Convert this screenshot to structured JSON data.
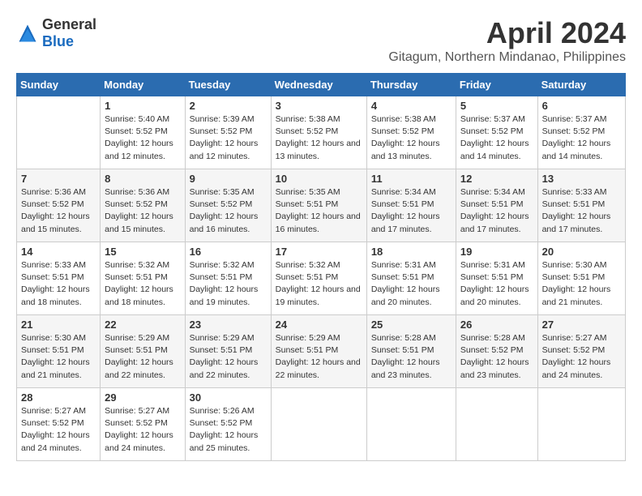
{
  "logo": {
    "general": "General",
    "blue": "Blue"
  },
  "title": "April 2024",
  "location": "Gitagum, Northern Mindanao, Philippines",
  "days_of_week": [
    "Sunday",
    "Monday",
    "Tuesday",
    "Wednesday",
    "Thursday",
    "Friday",
    "Saturday"
  ],
  "weeks": [
    [
      {
        "day": "",
        "sunrise": "",
        "sunset": "",
        "daylight": ""
      },
      {
        "day": "1",
        "sunrise": "Sunrise: 5:40 AM",
        "sunset": "Sunset: 5:52 PM",
        "daylight": "Daylight: 12 hours and 12 minutes."
      },
      {
        "day": "2",
        "sunrise": "Sunrise: 5:39 AM",
        "sunset": "Sunset: 5:52 PM",
        "daylight": "Daylight: 12 hours and 12 minutes."
      },
      {
        "day": "3",
        "sunrise": "Sunrise: 5:38 AM",
        "sunset": "Sunset: 5:52 PM",
        "daylight": "Daylight: 12 hours and 13 minutes."
      },
      {
        "day": "4",
        "sunrise": "Sunrise: 5:38 AM",
        "sunset": "Sunset: 5:52 PM",
        "daylight": "Daylight: 12 hours and 13 minutes."
      },
      {
        "day": "5",
        "sunrise": "Sunrise: 5:37 AM",
        "sunset": "Sunset: 5:52 PM",
        "daylight": "Daylight: 12 hours and 14 minutes."
      },
      {
        "day": "6",
        "sunrise": "Sunrise: 5:37 AM",
        "sunset": "Sunset: 5:52 PM",
        "daylight": "Daylight: 12 hours and 14 minutes."
      }
    ],
    [
      {
        "day": "7",
        "sunrise": "Sunrise: 5:36 AM",
        "sunset": "Sunset: 5:52 PM",
        "daylight": "Daylight: 12 hours and 15 minutes."
      },
      {
        "day": "8",
        "sunrise": "Sunrise: 5:36 AM",
        "sunset": "Sunset: 5:52 PM",
        "daylight": "Daylight: 12 hours and 15 minutes."
      },
      {
        "day": "9",
        "sunrise": "Sunrise: 5:35 AM",
        "sunset": "Sunset: 5:52 PM",
        "daylight": "Daylight: 12 hours and 16 minutes."
      },
      {
        "day": "10",
        "sunrise": "Sunrise: 5:35 AM",
        "sunset": "Sunset: 5:51 PM",
        "daylight": "Daylight: 12 hours and 16 minutes."
      },
      {
        "day": "11",
        "sunrise": "Sunrise: 5:34 AM",
        "sunset": "Sunset: 5:51 PM",
        "daylight": "Daylight: 12 hours and 17 minutes."
      },
      {
        "day": "12",
        "sunrise": "Sunrise: 5:34 AM",
        "sunset": "Sunset: 5:51 PM",
        "daylight": "Daylight: 12 hours and 17 minutes."
      },
      {
        "day": "13",
        "sunrise": "Sunrise: 5:33 AM",
        "sunset": "Sunset: 5:51 PM",
        "daylight": "Daylight: 12 hours and 17 minutes."
      }
    ],
    [
      {
        "day": "14",
        "sunrise": "Sunrise: 5:33 AM",
        "sunset": "Sunset: 5:51 PM",
        "daylight": "Daylight: 12 hours and 18 minutes."
      },
      {
        "day": "15",
        "sunrise": "Sunrise: 5:32 AM",
        "sunset": "Sunset: 5:51 PM",
        "daylight": "Daylight: 12 hours and 18 minutes."
      },
      {
        "day": "16",
        "sunrise": "Sunrise: 5:32 AM",
        "sunset": "Sunset: 5:51 PM",
        "daylight": "Daylight: 12 hours and 19 minutes."
      },
      {
        "day": "17",
        "sunrise": "Sunrise: 5:32 AM",
        "sunset": "Sunset: 5:51 PM",
        "daylight": "Daylight: 12 hours and 19 minutes."
      },
      {
        "day": "18",
        "sunrise": "Sunrise: 5:31 AM",
        "sunset": "Sunset: 5:51 PM",
        "daylight": "Daylight: 12 hours and 20 minutes."
      },
      {
        "day": "19",
        "sunrise": "Sunrise: 5:31 AM",
        "sunset": "Sunset: 5:51 PM",
        "daylight": "Daylight: 12 hours and 20 minutes."
      },
      {
        "day": "20",
        "sunrise": "Sunrise: 5:30 AM",
        "sunset": "Sunset: 5:51 PM",
        "daylight": "Daylight: 12 hours and 21 minutes."
      }
    ],
    [
      {
        "day": "21",
        "sunrise": "Sunrise: 5:30 AM",
        "sunset": "Sunset: 5:51 PM",
        "daylight": "Daylight: 12 hours and 21 minutes."
      },
      {
        "day": "22",
        "sunrise": "Sunrise: 5:29 AM",
        "sunset": "Sunset: 5:51 PM",
        "daylight": "Daylight: 12 hours and 22 minutes."
      },
      {
        "day": "23",
        "sunrise": "Sunrise: 5:29 AM",
        "sunset": "Sunset: 5:51 PM",
        "daylight": "Daylight: 12 hours and 22 minutes."
      },
      {
        "day": "24",
        "sunrise": "Sunrise: 5:29 AM",
        "sunset": "Sunset: 5:51 PM",
        "daylight": "Daylight: 12 hours and 22 minutes."
      },
      {
        "day": "25",
        "sunrise": "Sunrise: 5:28 AM",
        "sunset": "Sunset: 5:51 PM",
        "daylight": "Daylight: 12 hours and 23 minutes."
      },
      {
        "day": "26",
        "sunrise": "Sunrise: 5:28 AM",
        "sunset": "Sunset: 5:52 PM",
        "daylight": "Daylight: 12 hours and 23 minutes."
      },
      {
        "day": "27",
        "sunrise": "Sunrise: 5:27 AM",
        "sunset": "Sunset: 5:52 PM",
        "daylight": "Daylight: 12 hours and 24 minutes."
      }
    ],
    [
      {
        "day": "28",
        "sunrise": "Sunrise: 5:27 AM",
        "sunset": "Sunset: 5:52 PM",
        "daylight": "Daylight: 12 hours and 24 minutes."
      },
      {
        "day": "29",
        "sunrise": "Sunrise: 5:27 AM",
        "sunset": "Sunset: 5:52 PM",
        "daylight": "Daylight: 12 hours and 24 minutes."
      },
      {
        "day": "30",
        "sunrise": "Sunrise: 5:26 AM",
        "sunset": "Sunset: 5:52 PM",
        "daylight": "Daylight: 12 hours and 25 minutes."
      },
      {
        "day": "",
        "sunrise": "",
        "sunset": "",
        "daylight": ""
      },
      {
        "day": "",
        "sunrise": "",
        "sunset": "",
        "daylight": ""
      },
      {
        "day": "",
        "sunrise": "",
        "sunset": "",
        "daylight": ""
      },
      {
        "day": "",
        "sunrise": "",
        "sunset": "",
        "daylight": ""
      }
    ]
  ]
}
